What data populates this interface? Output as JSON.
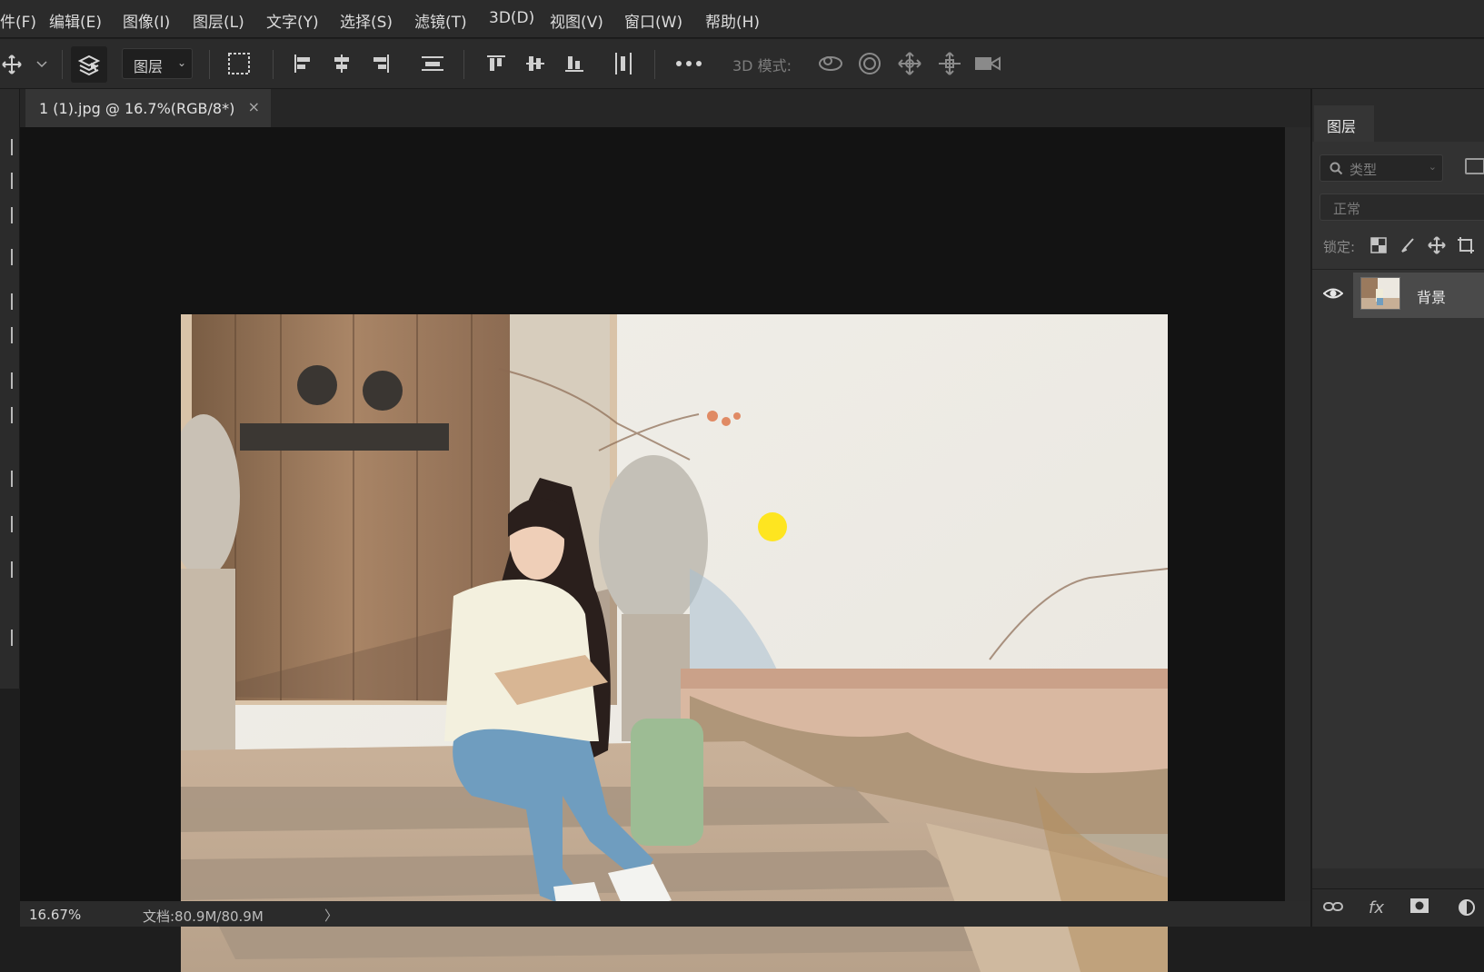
{
  "menu": {
    "items": [
      "件(F)",
      "编辑(E)",
      "图像(I)",
      "图层(L)",
      "文字(Y)",
      "选择(S)",
      "滤镜(T)",
      "3D(D)",
      "视图(V)",
      "窗口(W)",
      "帮助(H)"
    ]
  },
  "options_bar": {
    "layer_dropdown": "图层",
    "mode_3d_label": "3D 模式:",
    "icons": [
      "move-tool-icon",
      "auto-select-icon",
      "transform-controls-icon",
      "align-left-icon",
      "align-hcenter-icon",
      "align-right-icon",
      "distribute-vertical-icon",
      "align-top-icon",
      "align-vcenter-icon",
      "align-bottom-icon",
      "distribute-horizontal-icon",
      "more-icon",
      "orbit-3d-icon",
      "roll-3d-icon",
      "pan-3d-icon",
      "slide-3d-icon",
      "scale-3d-icon"
    ]
  },
  "document": {
    "tab_title": "1 (1).jpg @ 16.7%(RGB/8*)",
    "close_glyph": "×"
  },
  "status": {
    "zoom": "16.67%",
    "doc_info": "文档:80.9M/80.9M",
    "arrow": "〉"
  },
  "layers_panel": {
    "tab_label": "图层",
    "filter_placeholder": "类型",
    "blend_mode": "正常",
    "lock_label": "锁定:",
    "layers": [
      {
        "name": "背景",
        "visible": true
      }
    ],
    "bottom_icons": [
      "link-layers-icon",
      "fx-icon",
      "add-mask-icon",
      "adjustment-layer-icon"
    ],
    "fx_label": "fx"
  },
  "colors": {
    "app_bg": "#2b2b2b",
    "canvas_bg": "#131313",
    "cursor_highlight": "#ffe40a",
    "selected_layer": "#4a4a4a"
  }
}
